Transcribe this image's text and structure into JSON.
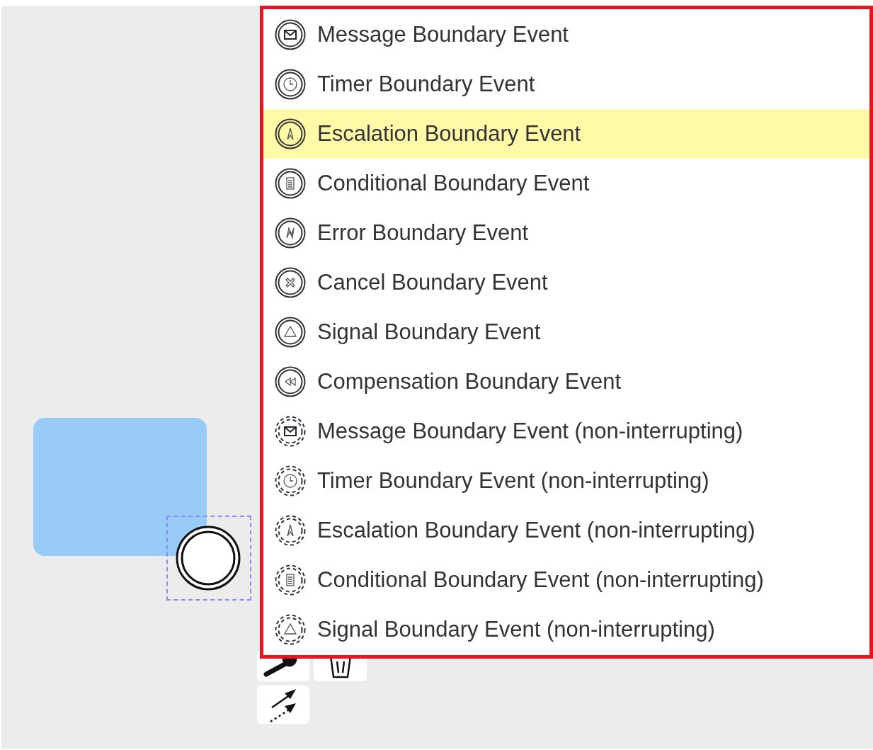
{
  "popup_menu": {
    "entries": [
      {
        "label": "Message Boundary Event",
        "kind": "message",
        "interrupting": true,
        "selected": false
      },
      {
        "label": "Timer Boundary Event",
        "kind": "timer",
        "interrupting": true,
        "selected": false
      },
      {
        "label": "Escalation Boundary Event",
        "kind": "escalation",
        "interrupting": true,
        "selected": true
      },
      {
        "label": "Conditional Boundary Event",
        "kind": "conditional",
        "interrupting": true,
        "selected": false
      },
      {
        "label": "Error Boundary Event",
        "kind": "error",
        "interrupting": true,
        "selected": false
      },
      {
        "label": "Cancel Boundary Event",
        "kind": "cancel",
        "interrupting": true,
        "selected": false
      },
      {
        "label": "Signal Boundary Event",
        "kind": "signal",
        "interrupting": true,
        "selected": false
      },
      {
        "label": "Compensation Boundary Event",
        "kind": "compensation",
        "interrupting": true,
        "selected": false
      },
      {
        "label": "Message Boundary Event (non-interrupting)",
        "kind": "message",
        "interrupting": false,
        "selected": false
      },
      {
        "label": "Timer Boundary Event (non-interrupting)",
        "kind": "timer",
        "interrupting": false,
        "selected": false
      },
      {
        "label": "Escalation Boundary Event (non-interrupting)",
        "kind": "escalation",
        "interrupting": false,
        "selected": false
      },
      {
        "label": "Conditional Boundary Event (non-interrupting)",
        "kind": "conditional",
        "interrupting": false,
        "selected": false
      },
      {
        "label": "Signal Boundary Event (non-interrupting)",
        "kind": "signal",
        "interrupting": false,
        "selected": false
      }
    ]
  }
}
